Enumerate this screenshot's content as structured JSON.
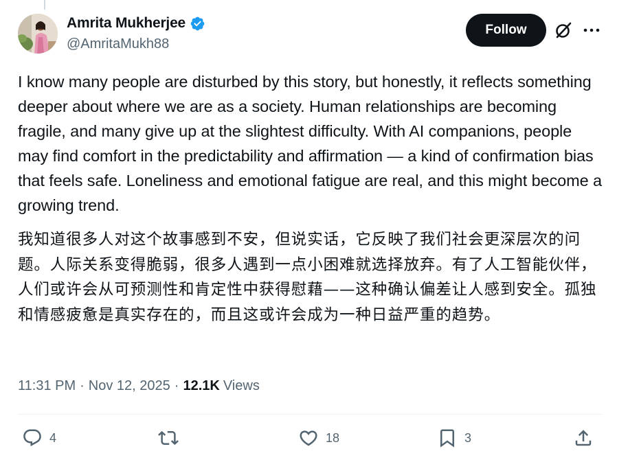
{
  "author": {
    "display_name": "Amrita Mukherjee",
    "handle": "@AmritaMukh88",
    "verified": true,
    "verified_color": "#1d9bf0"
  },
  "header": {
    "follow_label": "Follow",
    "grok_icon": "grok-slash-circle-icon",
    "more_icon": "more-dots-icon"
  },
  "tweet": {
    "text_en": "I know many people are disturbed by this story, but honestly, it reflects something deeper about where we are as a society. Human relationships are becoming fragile, and many give up at the slightest difficulty. With AI companions, people may find comfort in the predictability and affirmation — a kind of confirmation bias that feels safe. Loneliness and emotional fatigue are real, and this might become a growing trend.",
    "text_cn": "我知道很多人对这个故事感到不安，但说实话，它反映了我们社会更深层次的问题。人际关系变得脆弱，很多人遇到一点小困难就选择放弃。有了人工智能伙伴，人们或许会从可预测性和肯定性中获得慰藉——这种确认偏差让人感到安全。孤独和情感疲惫是真实存在的，而且这或许会成为一种日益严重的趋势。"
  },
  "meta": {
    "time": "11:31 PM",
    "separator": "·",
    "date": "Nov 12, 2025",
    "views_count": "12.1K",
    "views_label": "Views"
  },
  "actions": {
    "reply_count": "4",
    "repost_count": "",
    "like_count": "18",
    "bookmark_count": "3"
  },
  "colors": {
    "text_primary": "#0f1419",
    "text_secondary": "#536471",
    "divider": "#eff3f4",
    "button_bg": "#0f1419"
  }
}
